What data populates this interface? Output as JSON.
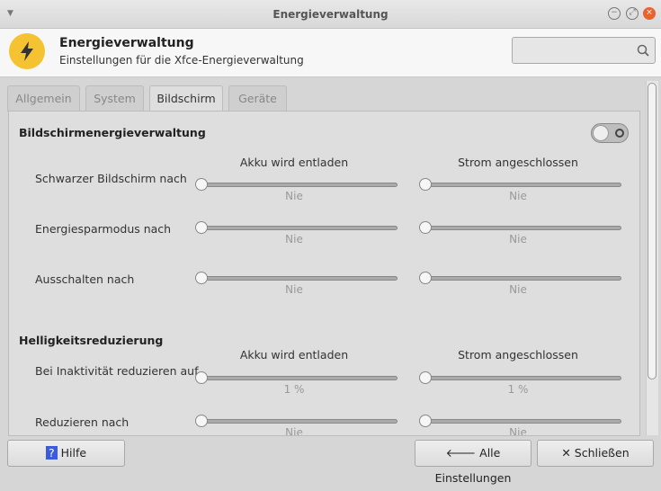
{
  "window": {
    "title": "Energieverwaltung"
  },
  "header": {
    "title": "Energieverwaltung",
    "subtitle": "Einstellungen für die Xfce-Energieverwaltung",
    "search_placeholder": ""
  },
  "tabs": [
    {
      "label": "Allgemein"
    },
    {
      "label": "System"
    },
    {
      "label": "Bildschirm",
      "active": true
    },
    {
      "label": "Geräte"
    }
  ],
  "display": {
    "section_title": "Bildschirmenergieverwaltung",
    "enabled": false,
    "col_battery": "Akku wird entladen",
    "col_ac": "Strom angeschlossen",
    "rows": [
      {
        "label": "Schwarzer Bildschirm nach",
        "battery": "Nie",
        "ac": "Nie"
      },
      {
        "label": "Energiesparmodus nach",
        "battery": "Nie",
        "ac": "Nie"
      },
      {
        "label": "Ausschalten nach",
        "battery": "Nie",
        "ac": "Nie"
      }
    ]
  },
  "brightness": {
    "section_title": "Helligkeitsreduzierung",
    "col_battery": "Akku wird entladen",
    "col_ac": "Strom angeschlossen",
    "rows": [
      {
        "label": "Bei Inaktivität reduzieren auf",
        "battery": "1 %",
        "ac": "1 %"
      },
      {
        "label": "Reduzieren nach",
        "battery": "Nie",
        "ac": "Nie"
      }
    ]
  },
  "footer": {
    "help": "Hilfe",
    "help_icon": "?",
    "all_settings": "Alle Einstellungen",
    "close": "Schließen"
  }
}
